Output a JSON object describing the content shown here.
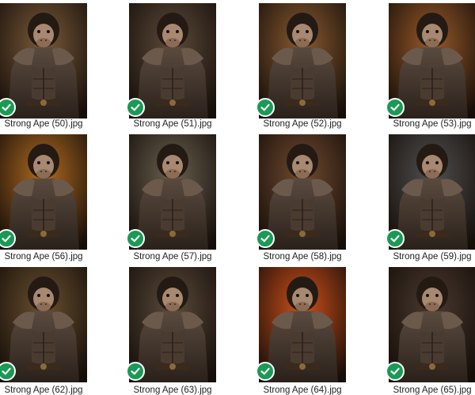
{
  "colors": {
    "status_check": "#1a9a54",
    "caption_text": "#222222"
  },
  "icons": {
    "status": "check-circle-icon"
  },
  "files": [
    {
      "name": "Strong Ape (50).jpg",
      "accent": "#7a5a3a"
    },
    {
      "name": "Strong Ape (51).jpg",
      "accent": "#5c4a3a"
    },
    {
      "name": "Strong Ape (52).jpg",
      "accent": "#8a5a30"
    },
    {
      "name": "Strong Ape (53).jpg",
      "accent": "#9a5a2a"
    },
    {
      "name": "Strong Ape (56).jpg",
      "accent": "#b06a20"
    },
    {
      "name": "Strong Ape (57).jpg",
      "accent": "#6a6050"
    },
    {
      "name": "Strong Ape (58).jpg",
      "accent": "#704a30"
    },
    {
      "name": "Strong Ape (59).jpg",
      "accent": "#505050"
    },
    {
      "name": "Strong Ape (62).jpg",
      "accent": "#6a5030"
    },
    {
      "name": "Strong Ape (63).jpg",
      "accent": "#5a4a3a"
    },
    {
      "name": "Strong Ape (64).jpg",
      "accent": "#d0501a"
    },
    {
      "name": "Strong Ape (65).jpg",
      "accent": "#4a3a30"
    }
  ]
}
